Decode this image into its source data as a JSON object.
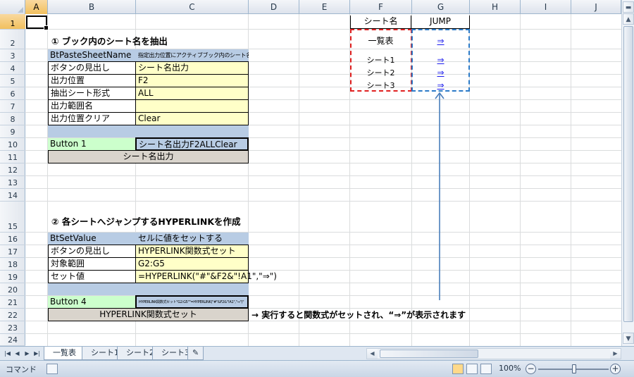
{
  "columns": [
    "A",
    "B",
    "C",
    "D",
    "E",
    "F",
    "G",
    "H",
    "I",
    "J"
  ],
  "rows": [
    "1",
    "2",
    "3",
    "4",
    "5",
    "6",
    "7",
    "8",
    "9",
    "10",
    "11",
    "12",
    "13",
    "14",
    "15",
    "16",
    "17",
    "18",
    "19",
    "20",
    "21",
    "22",
    "23",
    "24"
  ],
  "section1": {
    "heading": "① ブック内のシート名を抽出",
    "macro_name": "BtPasteSheetName",
    "macro_desc": "指定出力位置にアクティブブック内のシート名を抽出",
    "params": [
      {
        "label": "ボタンの見出し",
        "value": "シート名出力"
      },
      {
        "label": "出力位置",
        "value": "F2"
      },
      {
        "label": "抽出シート形式",
        "value": "ALL"
      },
      {
        "label": "出力範囲名",
        "value": ""
      },
      {
        "label": "出力位置クリア",
        "value": "Clear"
      }
    ],
    "button_cell": "Button 1",
    "button_code": "シート名出力F2ALLClear",
    "button_label": "シート名出力"
  },
  "section2": {
    "heading": "② 各シートへジャンプするHYPERLINKを作成",
    "macro_name": "BtSetValue",
    "macro_desc": "セルに値をセットする",
    "params": [
      {
        "label": "ボタンの見出し",
        "value": "HYPERLINK関数式セット"
      },
      {
        "label": "対象範囲",
        "value": "G2:G5"
      },
      {
        "label": "セット値",
        "value": "=HYPERLINK(\"#\"&F2&\"!A1\",\"⇒\")"
      }
    ],
    "button_cell": "Button 4",
    "button_code": "HYPERLINK関数式セット\"G2:G5\"\"=HYPERLINK(\"#\"&F2&\"!A1\",\"⇒\")\"",
    "button_label": "HYPERLINK関数式セット",
    "note": "→ 実行すると関数式がセットされ、“⇒”が表示されます"
  },
  "sheet_table": {
    "header_name": "シート名",
    "header_jump": "JUMP",
    "rows": [
      {
        "name": "一覧表",
        "jump": "⇒"
      },
      {
        "name": "シート1",
        "jump": "⇒"
      },
      {
        "name": "シート2",
        "jump": "⇒"
      },
      {
        "name": "シート3",
        "jump": "⇒"
      }
    ]
  },
  "tabs": [
    "一覧表",
    "シート1",
    "シート2",
    "シート3"
  ],
  "status": {
    "mode": "コマンド",
    "zoom": "100%",
    "zoom_percent": 100
  },
  "colors": {
    "header_blue": "#b8cce4",
    "input_yellow": "#ffffc8",
    "button_green": "#ccffcc",
    "button_gray": "#d9d4cc",
    "dash_red": "#e02020",
    "dash_blue": "#2c7bc8",
    "link_blue": "#1a1aee"
  }
}
